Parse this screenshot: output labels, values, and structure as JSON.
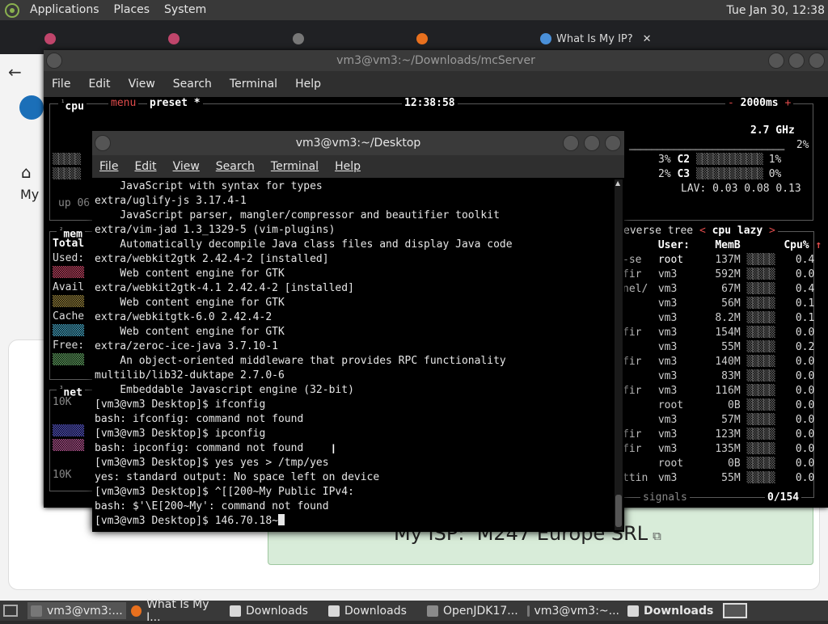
{
  "top_panel": {
    "menus": [
      "Applications",
      "Places",
      "System"
    ],
    "clock": "Tue Jan 30, 12:38"
  },
  "browser": {
    "tabs": [
      {
        "label": "",
        "active": false
      },
      {
        "label": "",
        "active": false
      },
      {
        "label": "",
        "active": false
      },
      {
        "label": "",
        "active": false
      },
      {
        "label": "What Is My IP?",
        "active": true
      }
    ],
    "home_label": "My",
    "isp_label": "My ISP:",
    "isp_value": "M247 Europe SRL"
  },
  "back_terminal": {
    "title": "vm3@vm3:~/Downloads/mcServer",
    "menu": [
      "File",
      "Edit",
      "View",
      "Search",
      "Terminal",
      "Help"
    ],
    "btop": {
      "cpu_header": [
        "cpu",
        "menu",
        "preset *"
      ],
      "time": "12:38:58",
      "refresh": "2000ms",
      "ghz": "2.7 GHz",
      "cpu_rows": [
        {
          "left_pct": "",
          "label": "",
          "right_pct": "2%"
        },
        {
          "left_pct": "3%",
          "label": "C2",
          "right_pct": "1%"
        },
        {
          "left_pct": "2%",
          "label": "C3",
          "right_pct": "0%"
        }
      ],
      "lav": "LAV: 0.03 0.08 0.13",
      "uptime": "up 06",
      "mem_header": "mem",
      "mem_labels": [
        "Total",
        "Used:",
        "Avail",
        "Cache",
        "Free:"
      ],
      "net_header": "net",
      "net_labels": [
        "10K",
        "10K"
      ],
      "proc_header": [
        "everse",
        "tree",
        "cpu lazy"
      ],
      "proc_columns": [
        "User:",
        "MemB",
        "Cpu%"
      ],
      "proc_rows": [
        {
          "prefix": "-se",
          "user": "root",
          "mem": "137M",
          "cpu": "0.4"
        },
        {
          "prefix": "fir",
          "user": "vm3",
          "mem": "592M",
          "cpu": "0.0"
        },
        {
          "prefix": "nel/",
          "user": "vm3",
          "mem": "67M",
          "cpu": "0.4"
        },
        {
          "prefix": "",
          "user": "vm3",
          "mem": "56M",
          "cpu": "0.1"
        },
        {
          "prefix": "",
          "user": "vm3",
          "mem": "8.2M",
          "cpu": "0.1"
        },
        {
          "prefix": "fir",
          "user": "vm3",
          "mem": "154M",
          "cpu": "0.0"
        },
        {
          "prefix": "",
          "user": "vm3",
          "mem": "55M",
          "cpu": "0.2"
        },
        {
          "prefix": "fir",
          "user": "vm3",
          "mem": "140M",
          "cpu": "0.0"
        },
        {
          "prefix": "",
          "user": "vm3",
          "mem": "83M",
          "cpu": "0.0"
        },
        {
          "prefix": "fir",
          "user": "vm3",
          "mem": "116M",
          "cpu": "0.0"
        },
        {
          "prefix": "",
          "user": "root",
          "mem": "0B",
          "cpu": "0.0"
        },
        {
          "prefix": "",
          "user": "vm3",
          "mem": "57M",
          "cpu": "0.0"
        },
        {
          "prefix": "fir",
          "user": "vm3",
          "mem": "123M",
          "cpu": "0.0"
        },
        {
          "prefix": "fir",
          "user": "vm3",
          "mem": "135M",
          "cpu": "0.0"
        },
        {
          "prefix": "",
          "user": "root",
          "mem": "0B",
          "cpu": "0.0"
        },
        {
          "prefix": "ttin",
          "user": "vm3",
          "mem": "55M",
          "cpu": "0.0"
        }
      ],
      "proc_footer": "signals",
      "proc_count": "0/154"
    }
  },
  "front_terminal": {
    "title": "vm3@vm3:~/Desktop",
    "menu": [
      "File",
      "Edit",
      "View",
      "Search",
      "Terminal",
      "Help"
    ],
    "lines": [
      "    JavaScript with syntax for types",
      "extra/uglify-js 3.17.4-1",
      "    JavaScript parser, mangler/compressor and beautifier toolkit",
      "extra/vim-jad 1.3_1329-5 (vim-plugins)",
      "    Automatically decompile Java class files and display Java code",
      "extra/webkit2gtk 2.42.4-2 [installed]",
      "    Web content engine for GTK",
      "extra/webkit2gtk-4.1 2.42.4-2 [installed]",
      "    Web content engine for GTK",
      "extra/webkitgtk-6.0 2.42.4-2",
      "    Web content engine for GTK",
      "extra/zeroc-ice-java 3.7.10-1",
      "    An object-oriented middleware that provides RPC functionality",
      "multilib/lib32-duktape 2.7.0-6",
      "    Embeddable Javascript engine (32-bit)",
      "[vm3@vm3 Desktop]$ ifconfig",
      "bash: ifconfig: command not found",
      "[vm3@vm3 Desktop]$ ipconfig",
      "bash: ipconfig: command not found",
      "[vm3@vm3 Desktop]$ yes yes > /tmp/yes",
      "yes: standard output: No space left on device",
      "[vm3@vm3 Desktop]$ ^[[200~My Public IPv4:",
      "bash: $'\\E[200~My': command not found"
    ],
    "prompt_line": "[vm3@vm3 Desktop]$ 146.70.18~"
  },
  "taskbar": {
    "items": [
      {
        "label": "vm3@vm3:...",
        "kind": "term",
        "active": true
      },
      {
        "label": "What Is My I...",
        "kind": "ff",
        "active": false
      },
      {
        "label": "Downloads",
        "kind": "folder",
        "active": false
      },
      {
        "label": "Downloads",
        "kind": "folder",
        "active": false
      },
      {
        "label": "OpenJDK17...",
        "kind": "java",
        "active": false
      },
      {
        "label": "vm3@vm3:~...",
        "kind": "term",
        "active": false
      },
      {
        "label": "Downloads",
        "kind": "folder",
        "active": false,
        "bold": true
      }
    ]
  }
}
